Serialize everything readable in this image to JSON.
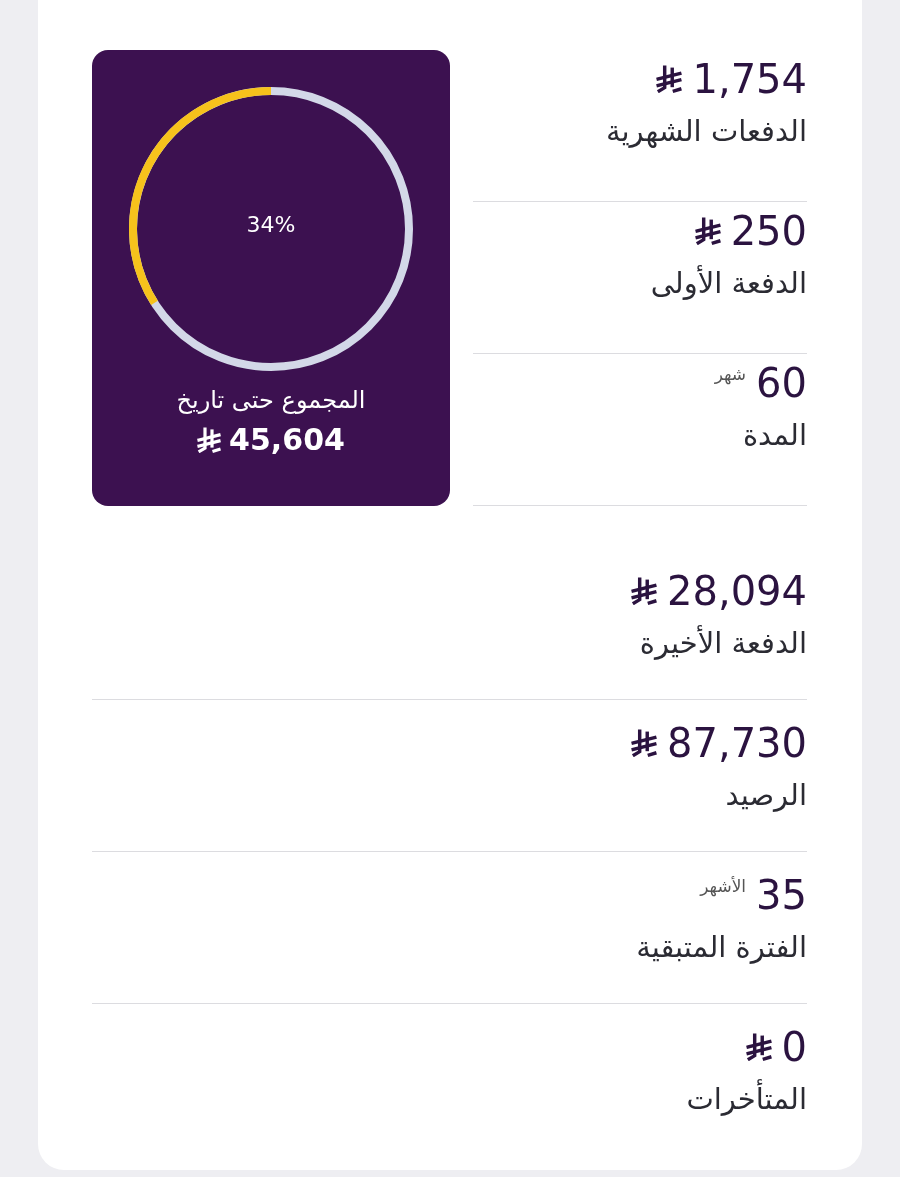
{
  "progress_panel": {
    "percent": "34%",
    "label": "المجموع حتى تاريخ",
    "value": "45,604"
  },
  "summary_items": [
    {
      "kind": "currency",
      "value": "1,754",
      "label": "الدفعات الشهرية"
    },
    {
      "kind": "currency",
      "value": "250",
      "label": "الدفعة الأولى"
    },
    {
      "kind": "duration",
      "value": "60",
      "unit": "شهر",
      "label": "المدة"
    }
  ],
  "items": [
    {
      "kind": "currency",
      "value": "28,094",
      "label": "الدفعة الأخيرة"
    },
    {
      "kind": "currency",
      "value": "87,730",
      "label": "الرصيد"
    },
    {
      "kind": "duration",
      "value": "35",
      "unit": "الأشهر",
      "label": "الفترة المتبقية"
    },
    {
      "kind": "currency",
      "value": "0",
      "label": "المتأخرات"
    }
  ]
}
